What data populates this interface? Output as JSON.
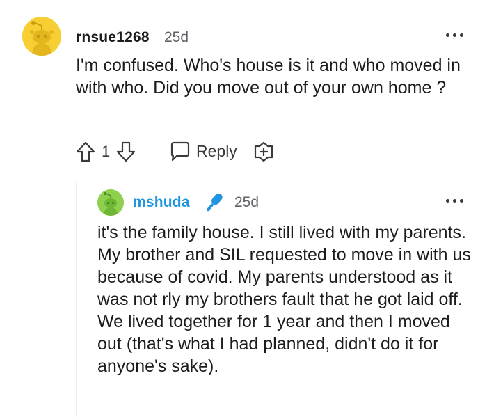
{
  "comments": [
    {
      "username": "rnsue1268",
      "time": "25d",
      "body": "I'm confused. Who's house is it and who moved in with who. Did you move out of your own home ?",
      "votes": "1",
      "reply_label": "Reply",
      "avatar_color": "#f7cf34"
    },
    {
      "username": "mshuda",
      "time": "25d",
      "body": "it's the family house. I still lived with my parents. My brother and SIL requested to move in with us because of covid. My parents understood as it was not rly my brothers fault that he got laid off. We lived together for 1 year and then I moved out (that's what I had planned, didn't do it for anyone's sake).",
      "avatar_color": "#8fd14f",
      "username_color": "#2196e0",
      "flair_icon": "microphone-icon"
    }
  ]
}
